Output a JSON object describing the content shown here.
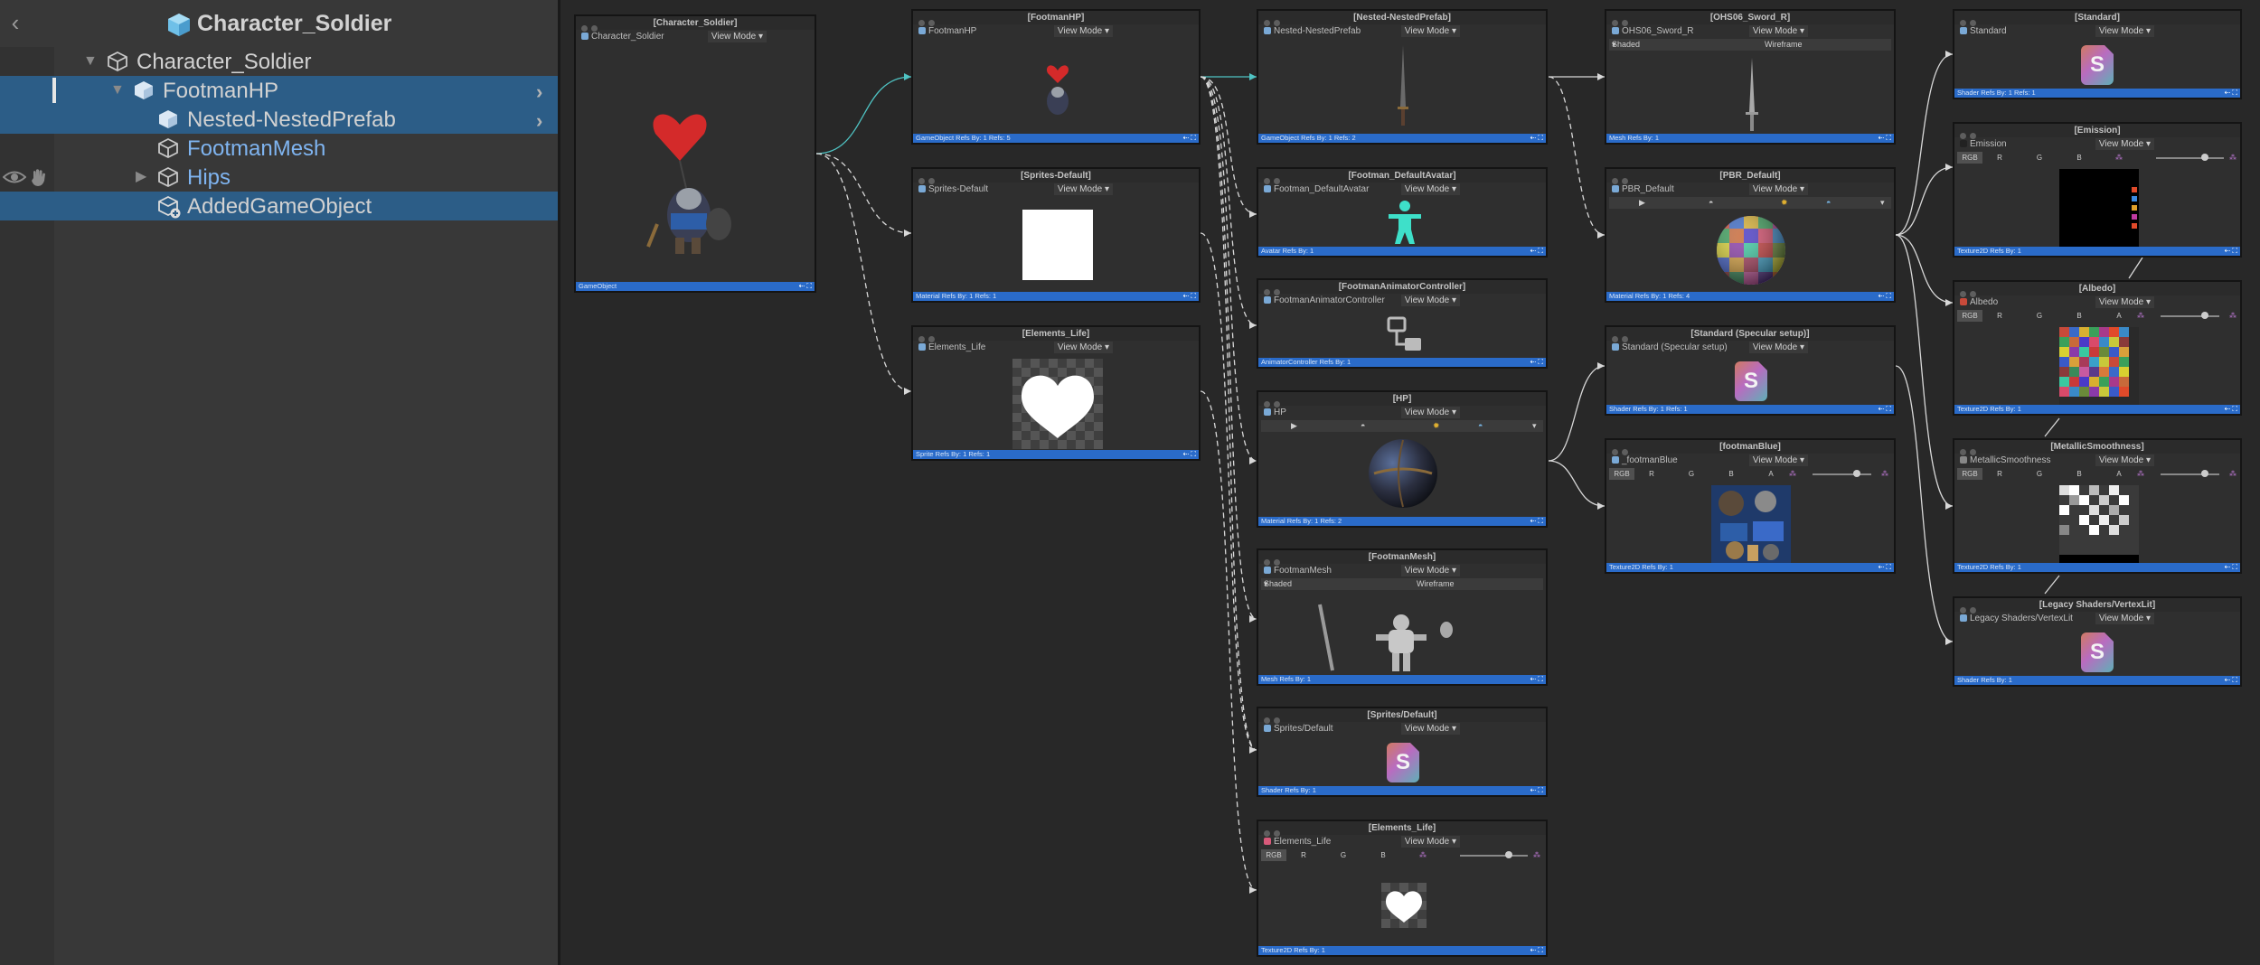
{
  "hierarchy": {
    "title": "Character_Soldier",
    "back_glyph": "‹",
    "rows": [
      {
        "label": "Character_Soldier"
      },
      {
        "label": "FootmanHP"
      },
      {
        "label": "Nested-NestedPrefab"
      },
      {
        "label": "FootmanMesh"
      },
      {
        "label": "Hips"
      },
      {
        "label": "AddedGameObject"
      }
    ]
  },
  "common": {
    "view_mode": "View Mode ▾",
    "shaded": "Shaded",
    "wireframe": "Wireframe",
    "shaded_caret": "▾"
  },
  "nodes": {
    "character_soldier": {
      "title": "[Character_Soldier]",
      "name": "Character_Soldier",
      "footer": "GameObject"
    },
    "footman_hp": {
      "title": "[FootmanHP]",
      "name": "FootmanHP",
      "footer": "GameObject Refs By: 1 Refs: 5"
    },
    "sprites_default": {
      "title": "[Sprites-Default]",
      "name": "Sprites-Default",
      "footer": "Material Refs By: 1 Refs: 1"
    },
    "elements_life": {
      "title": "[Elements_Life]",
      "name": "Elements_Life",
      "footer": "Sprite Refs By: 1 Refs: 1"
    },
    "nested_prefab": {
      "title": "[Nested-NestedPrefab]",
      "name": "Nested-NestedPrefab",
      "footer": "GameObject Refs By: 1 Refs: 2"
    },
    "default_avatar": {
      "title": "[Footman_DefaultAvatar]",
      "name": "Footman_DefaultAvatar",
      "footer": "Avatar Refs By: 1"
    },
    "animator": {
      "title": "[FootmanAnimatorController]",
      "name": "FootmanAnimatorController",
      "footer": "AnimatorController Refs By: 1"
    },
    "hp": {
      "title": "[HP]",
      "name": "HP",
      "footer": "Material Refs By: 1 Refs: 2"
    },
    "footman_mesh": {
      "title": "[FootmanMesh]",
      "name": "FootmanMesh",
      "footer": "Mesh Refs By: 1"
    },
    "sprites_default_shader": {
      "title": "[Sprites/Default]",
      "name": "Sprites/Default",
      "footer": "Shader Refs By: 1"
    },
    "elements_life_tex": {
      "title": "[Elements_Life]",
      "name": "Elements_Life",
      "footer": "Texture2D Refs By: 1"
    },
    "sword": {
      "title": "[OHS06_Sword_R]",
      "name": "OHS06_Sword_R",
      "footer": "Mesh Refs By: 1"
    },
    "pbr_default": {
      "title": "[PBR_Default]",
      "name": "PBR_Default",
      "footer": "Material Refs By: 1 Refs: 4"
    },
    "standard_specular": {
      "title": "[Standard (Specular setup)]",
      "name": "Standard (Specular setup)",
      "footer": "Shader Refs By: 1 Refs: 1"
    },
    "footman_blue": {
      "title": "[footmanBlue]",
      "name": "_footmanBlue",
      "footer": "Texture2D Refs By: 1"
    },
    "standard": {
      "title": "[Standard]",
      "name": "Standard",
      "footer": "Shader Refs By: 1 Refs: 1"
    },
    "emission": {
      "title": "[Emission]",
      "name": "Emission",
      "footer": "Texture2D Refs By: 1"
    },
    "albedo": {
      "title": "[Albedo]",
      "name": "Albedo",
      "footer": "Texture2D Refs By: 1"
    },
    "metallic": {
      "title": "[MetallicSmoothness]",
      "name": "MetallicSmoothness",
      "footer": "Texture2D Refs By: 1"
    },
    "legacy": {
      "title": "[Legacy Shaders/VertexLit]",
      "name": "Legacy Shaders/VertexLit",
      "footer": "Shader Refs By: 1"
    }
  },
  "channels": {
    "rgb": "RGB",
    "r": "R",
    "g": "G",
    "b": "B",
    "a": "A"
  },
  "shader_glyph": "S",
  "icons": [
    "cube-icon",
    "eye-icon",
    "hand-icon",
    "play-icon",
    "sphere-icon",
    "chevron-right-icon"
  ],
  "colors": {
    "selection": "#2c5d87",
    "footer": "#2a6bc9",
    "wire": "#d8d8d8",
    "active_wire": "#4fc3c3"
  }
}
